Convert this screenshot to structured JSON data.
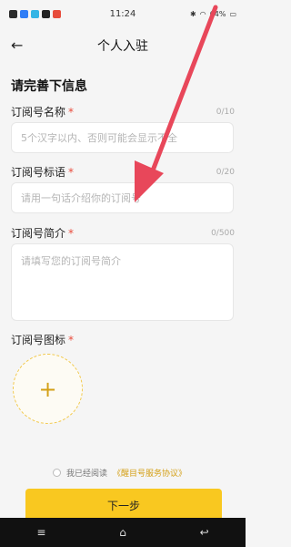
{
  "status_bar": {
    "time": "11:24",
    "battery": "64%",
    "app_icon_colors": [
      "#2b2b2b",
      "#2f7df6",
      "#33b5e5",
      "#222222",
      "#e74c3c"
    ]
  },
  "header": {
    "title": "个人入驻"
  },
  "form": {
    "section_title": "请完善下信息",
    "required_mark": "*",
    "name": {
      "label": "订阅号名称",
      "counter": "0/10",
      "placeholder": "5个汉字以内、否则可能会显示不全"
    },
    "slogan": {
      "label": "订阅号标语",
      "counter": "0/20",
      "placeholder": "请用一句话介绍你的订阅号"
    },
    "intro": {
      "label": "订阅号简介",
      "counter": "0/500",
      "placeholder": "请填写您的订阅号简介"
    },
    "icon": {
      "label": "订阅号图标",
      "upload_icon": "plus-icon"
    }
  },
  "agreement": {
    "prefix": "我已经阅读",
    "link": "《醒目号服务协议》"
  },
  "next_button": {
    "label": "下一步"
  },
  "nav_bar": {
    "menu_icon": "≡",
    "home_icon": "⌂",
    "back_icon": "↩"
  },
  "colors": {
    "accent": "#f9c820",
    "required": "#e94b3c",
    "arrow": "#e8475a"
  }
}
